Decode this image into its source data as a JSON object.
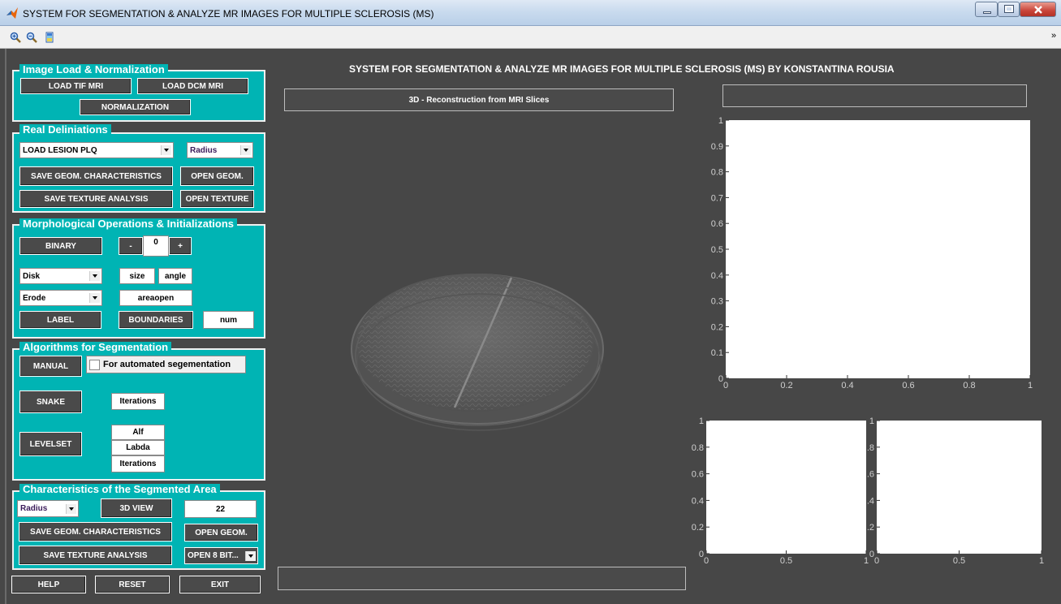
{
  "window": {
    "title": "SYSTEM FOR SEGMENTATION & ANALYZE MR IMAGES FOR MULTIPLE SCLEROSIS (MS)"
  },
  "toolbar": {
    "icons": [
      "zoom-in-icon",
      "zoom-out-icon",
      "colorbar-icon"
    ],
    "overflow": "»"
  },
  "header": {
    "title": "SYSTEM FOR SEGMENTATION & ANALYZE MR IMAGES FOR MULTIPLE SCLEROSIS (MS) BY KONSTANTINA ROUSIA"
  },
  "panels": {
    "load": {
      "title": "Image Load & Normalization",
      "load_tif": "LOAD TIF MRI",
      "load_dcm": "LOAD DCM MRI",
      "normalization": "NORMALIZATION"
    },
    "real": {
      "title": "Real Deliniations",
      "lesion_select": "LOAD LESION PLQ",
      "radius_select": "Radius",
      "save_geom": "SAVE GEOM. CHARACTERISTICS",
      "open_geom": "OPEN GEOM.",
      "save_texture": "SAVE TEXTURE ANALYSIS",
      "open_texture": "OPEN TEXTURE"
    },
    "morph": {
      "title": "Morphological Operations & Initializations",
      "binary": "BINARY",
      "minus": "-",
      "value": "0",
      "plus": "+",
      "shape_select": "Disk",
      "size": "size",
      "angle": "angle",
      "op_select": "Erode",
      "areaopen": "areaopen",
      "label": "LABEL",
      "boundaries": "BOUNDARIES",
      "num": "num"
    },
    "algo": {
      "title": "Algorithms for Segmentation",
      "manual": "MANUAL",
      "auto_checkbox": "For automated segementation",
      "snake": "SNAKE",
      "snake_iterations": "Iterations",
      "levelset": "LEVELSET",
      "alf": "Alf",
      "labda": "Labda",
      "ls_iterations": "Iterations"
    },
    "chars": {
      "title": "Characteristics of the Segmented Area",
      "radius_select": "Radius",
      "view3d": "3D VIEW",
      "value": "22",
      "save_geom": "SAVE GEOM. CHARACTERISTICS",
      "open_geom": "OPEN GEOM.",
      "save_texture": "SAVE TEXTURE ANALYSIS",
      "open_8bit": "OPEN 8 BIT..."
    }
  },
  "bottom": {
    "help": "HELP",
    "reset": "RESET",
    "exit": "EXIT"
  },
  "center": {
    "reconstruction_label": "3D - Reconstruction from MRI Slices"
  },
  "colors": {
    "panel": "#00b4b4",
    "background": "#474747",
    "button": "#4a4a4a"
  },
  "chart_data": [
    {
      "type": "line",
      "xlim": [
        0,
        1
      ],
      "ylim": [
        0,
        1
      ],
      "xticks": [
        "0",
        "0.2",
        "0.4",
        "0.6",
        "0.8",
        "1"
      ],
      "yticks": [
        "0",
        "0.1",
        "0.2",
        "0.3",
        "0.4",
        "0.5",
        "0.6",
        "0.7",
        "0.8",
        "0.9",
        "1"
      ],
      "series": []
    },
    {
      "type": "line",
      "xlim": [
        0,
        1
      ],
      "ylim": [
        0,
        1
      ],
      "xticks": [
        "0",
        "0.5",
        "1"
      ],
      "yticks": [
        "0",
        "0.2",
        "0.4",
        "0.6",
        "0.8",
        "1"
      ],
      "series": []
    },
    {
      "type": "line",
      "xlim": [
        0,
        1
      ],
      "ylim": [
        0,
        1
      ],
      "xticks": [
        "0",
        "0.5",
        "1"
      ],
      "yticks": [
        "0",
        "0.2",
        "0.4",
        "0.6",
        "0.8",
        "1"
      ],
      "series": []
    }
  ]
}
